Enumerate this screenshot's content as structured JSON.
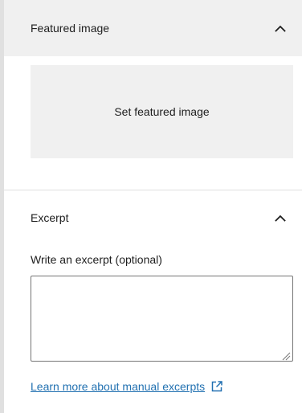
{
  "featured_image": {
    "title": "Featured image",
    "set_button_label": "Set featured image",
    "expanded": true
  },
  "excerpt": {
    "title": "Excerpt",
    "expanded": true,
    "field_label": "Write an excerpt (optional)",
    "value": "",
    "learn_more_text": "Learn more about manual excerpts"
  },
  "icons": {
    "collapse": "chevron-up-icon",
    "external_link": "external-link-icon",
    "resize": "resize-grip-icon"
  },
  "colors": {
    "header_bg": "#f0f0f0",
    "link": "#2271b1",
    "border": "#757575",
    "divider": "#e0e0e0"
  }
}
